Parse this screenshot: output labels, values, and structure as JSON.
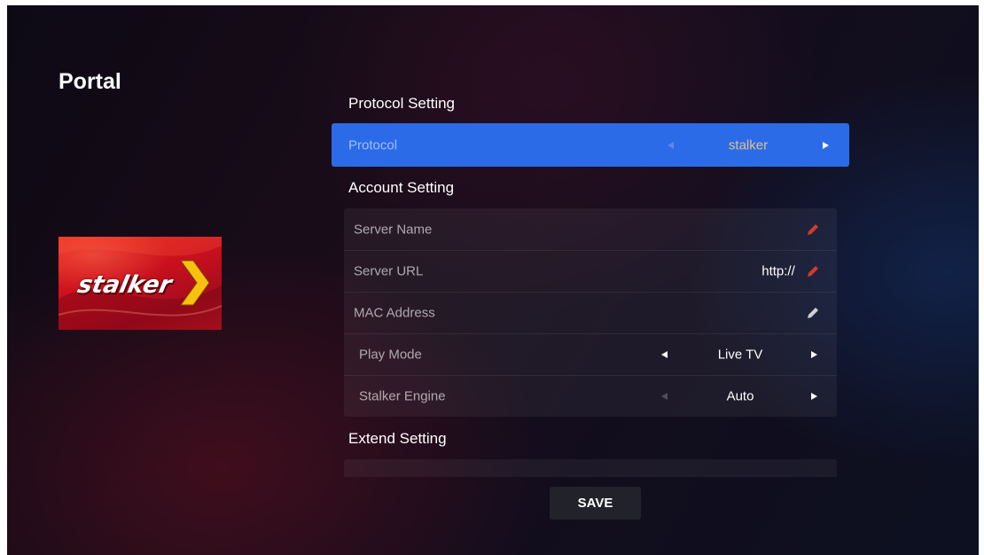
{
  "page": {
    "title": "Portal"
  },
  "logo": {
    "text": "stalker"
  },
  "protocol_section": {
    "header": "Protocol Setting",
    "protocol": {
      "label": "Protocol",
      "value": "stalker"
    }
  },
  "account_section": {
    "header": "Account Setting",
    "server_name": {
      "label": "Server Name",
      "value": ""
    },
    "server_url": {
      "label": "Server URL",
      "value": "http://"
    },
    "mac_address": {
      "label": "MAC Address",
      "value": ""
    },
    "play_mode": {
      "label": "Play Mode",
      "value": "Live TV"
    },
    "stalker_engine": {
      "label": "Stalker Engine",
      "value": "Auto"
    }
  },
  "extend_section": {
    "header": "Extend Setting"
  },
  "actions": {
    "save_label": "SAVE"
  },
  "colors": {
    "selected_row": "#2b6be8",
    "selected_value": "#e0c18a",
    "edit_icon_active": "#d13b2c",
    "edit_icon_default": "#cfcfcf",
    "logo_red": "#d4141e",
    "logo_chevron": "#f6c20f"
  },
  "icons": {
    "edit": "pencil-icon",
    "prev": "triangle-left-icon",
    "next": "triangle-right-icon"
  }
}
